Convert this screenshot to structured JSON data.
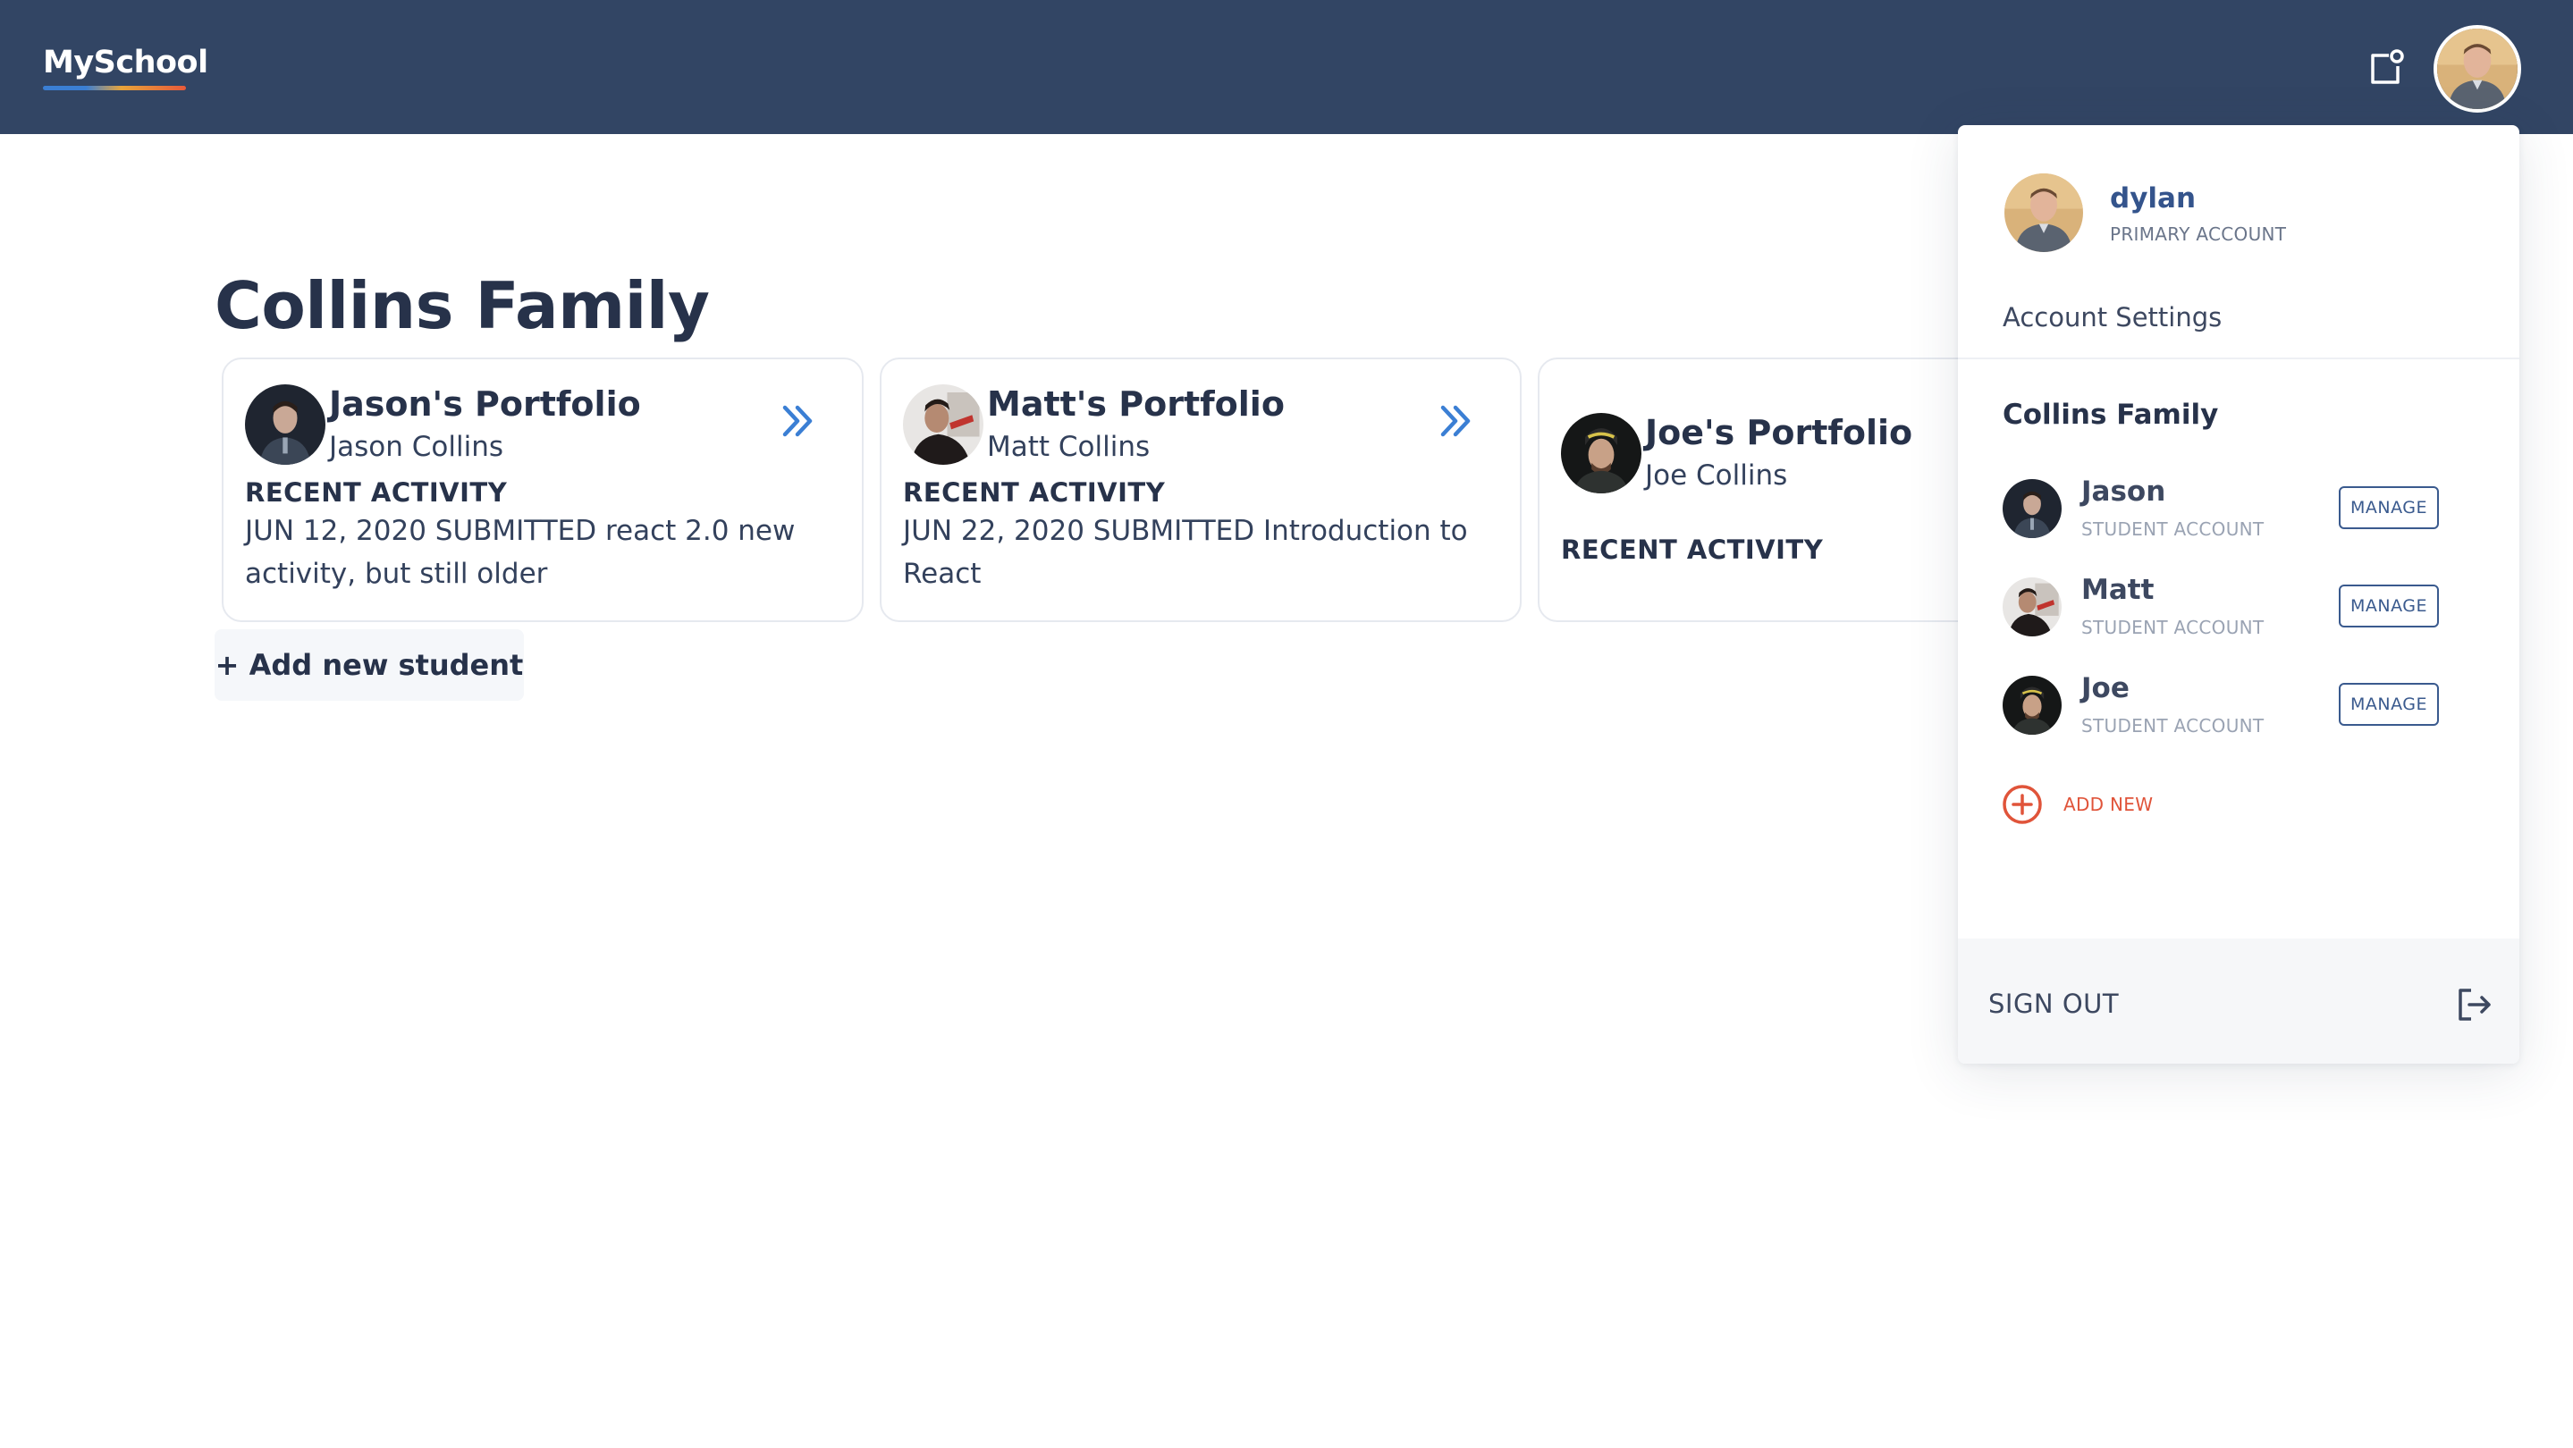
{
  "header": {
    "logo_text": "MySchool",
    "notification_icon": "notification-icon",
    "profile_icon": "user-avatar"
  },
  "main": {
    "title": "Collins Family",
    "add_student_label": "+ Add new student",
    "cards": [
      {
        "title": "Jason's Portfolio",
        "name": "Jason Collins",
        "recent_label": "RECENT ACTIVITY",
        "activity": "JUN 12, 2020 SUBMITTED react 2.0 new activity, but still older"
      },
      {
        "title": "Matt's Portfolio",
        "name": "Matt Collins",
        "recent_label": "RECENT ACTIVITY",
        "activity": "JUN 22, 2020 SUBMITTED Introduction to React"
      },
      {
        "title": "Joe's Portfolio",
        "name": "Joe Collins",
        "recent_label": "RECENT ACTIVITY",
        "activity": ""
      }
    ]
  },
  "dropdown": {
    "user_name": "dylan",
    "user_role": "PRIMARY ACCOUNT",
    "account_settings": "Account Settings",
    "family_name": "Collins Family",
    "members": [
      {
        "name": "Jason",
        "role": "STUDENT ACCOUNT",
        "action": "MANAGE"
      },
      {
        "name": "Matt",
        "role": "STUDENT ACCOUNT",
        "action": "MANAGE"
      },
      {
        "name": "Joe",
        "role": "STUDENT ACCOUNT",
        "action": "MANAGE"
      }
    ],
    "add_new_label": "ADD NEW",
    "sign_out_label": "SIGN OUT"
  },
  "colors": {
    "header_bg": "#324564",
    "accent_blue": "#3b7fd4",
    "accent_orange": "#e0543a",
    "text_dark": "#27324a"
  }
}
